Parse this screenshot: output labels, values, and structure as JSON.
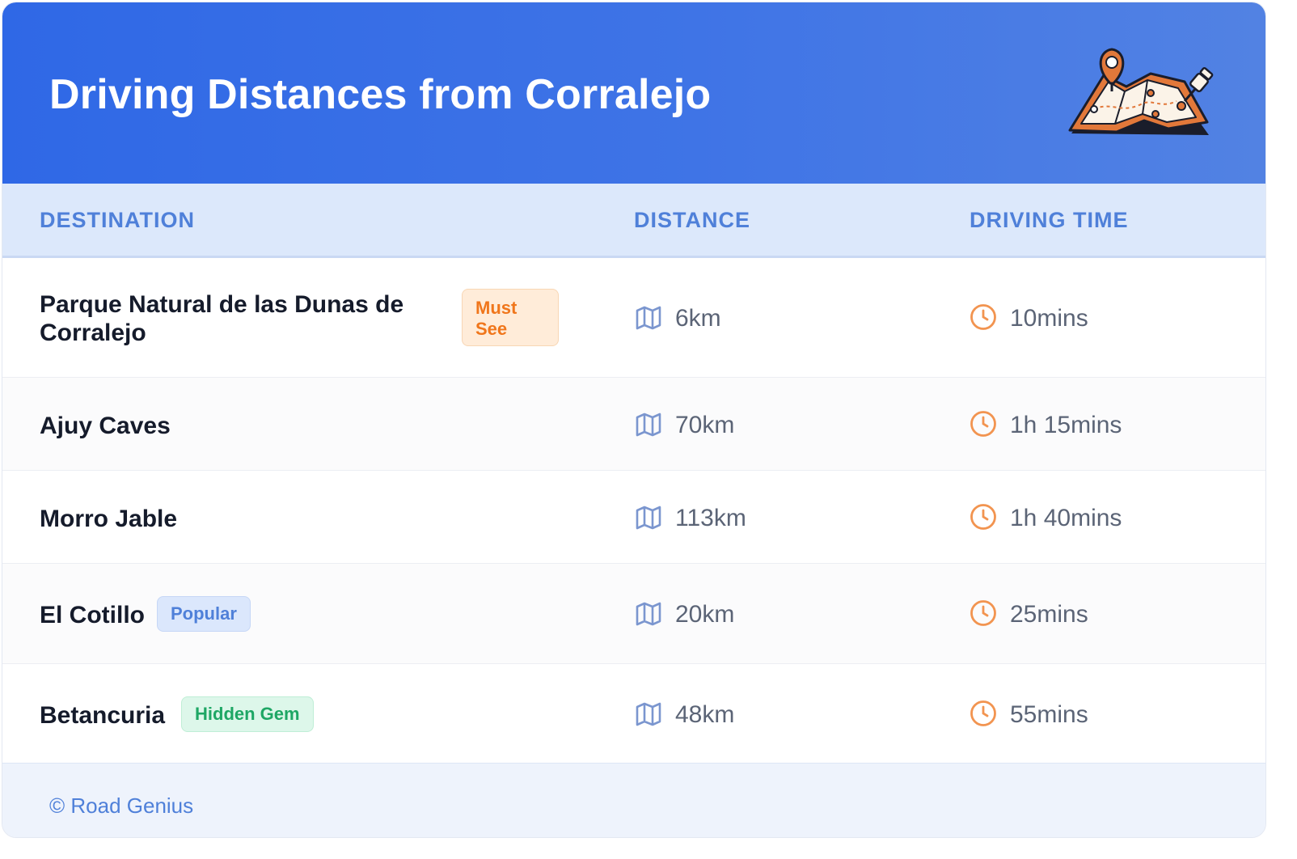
{
  "header": {
    "title": "Driving Distances from Corralejo",
    "illustration": "map-pin-illustration-icon"
  },
  "columns": {
    "destination": "DESTINATION",
    "distance": "DISTANCE",
    "time": "DRIVING TIME"
  },
  "rows": [
    {
      "destination_line1": "Parque Natural de las Dunas de",
      "destination_line2": "Corralejo",
      "badge_line1": "Must",
      "badge_line2": "See",
      "distance": "6km",
      "time": "10mins"
    },
    {
      "destination": "Ajuy Caves",
      "distance": "70km",
      "time": "1h 15mins"
    },
    {
      "destination": "Morro Jable",
      "distance": "113km",
      "time": "1h 40mins"
    },
    {
      "destination": "El Cotillo",
      "badge": "Popular",
      "distance": "20km",
      "time": "25mins"
    },
    {
      "destination": "Betancuria",
      "badge": "Hidden Gem",
      "distance": "48km",
      "time": "55mins"
    }
  ],
  "footer": {
    "credit": "© Road Genius"
  },
  "colors": {
    "header_start": "#2f68e6",
    "header_end": "#5282e3",
    "accent_blue": "#4f80d9",
    "clock_orange": "#f29450",
    "map_icon": "#7b96cf"
  }
}
